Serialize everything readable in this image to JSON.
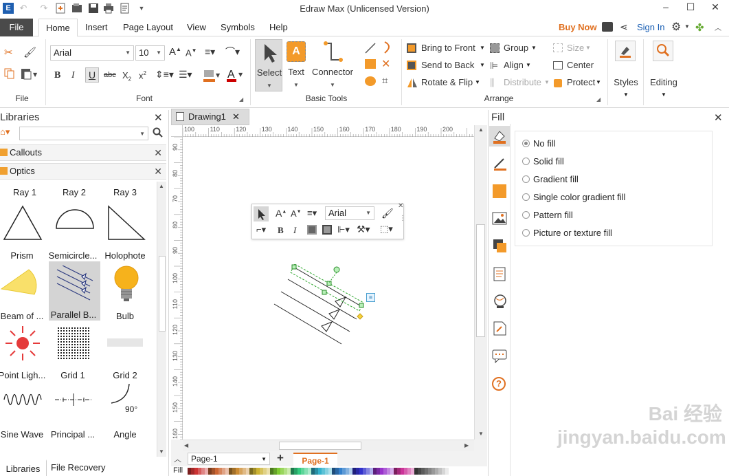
{
  "app": {
    "title": "Edraw Max (Unlicensed Version)"
  },
  "tabs": [
    "File",
    "Home",
    "Insert",
    "Page Layout",
    "View",
    "Symbols",
    "Help"
  ],
  "account": {
    "buy_now": "Buy Now",
    "sign_in": "Sign In"
  },
  "ribbon": {
    "groups": {
      "file": "File",
      "font": "Font",
      "basic_tools": "Basic Tools",
      "arrange": "Arrange"
    },
    "font_name": "Arial",
    "font_size": "10",
    "basic_tools": {
      "select": "Select",
      "text": "Text",
      "connector": "Connector"
    },
    "arrange": {
      "bring_to_front": "Bring to Front",
      "send_to_back": "Send to Back",
      "rotate_flip": "Rotate & Flip",
      "group": "Group",
      "align": "Align",
      "distribute": "Distribute",
      "size": "Size",
      "center": "Center",
      "protect": "Protect"
    },
    "styles": "Styles",
    "editing": "Editing"
  },
  "libraries": {
    "title": "Libraries",
    "categories": [
      "Callouts",
      "Optics"
    ],
    "shapes": [
      [
        "Ray 1",
        "Ray 2",
        "Ray 3"
      ],
      [
        "Prism",
        "Semicircle...",
        "Holophote"
      ],
      [
        "Beam of ...",
        "Parallel B...",
        "Bulb"
      ],
      [
        "Point Ligh...",
        "Grid 1",
        "Grid 2"
      ],
      [
        "Sine Wave",
        "Principal ...",
        "Angle"
      ]
    ],
    "angle_label": "90°",
    "bottom_tabs": [
      "Libraries",
      "File Recovery"
    ]
  },
  "document": {
    "tab": "Drawing1",
    "h_ruler": [
      "100",
      "110",
      "120",
      "130",
      "140",
      "150",
      "160",
      "170",
      "180",
      "190",
      "200"
    ],
    "v_ruler": [
      "90",
      "80",
      "70",
      "80",
      "90",
      "100",
      "110",
      "120",
      "130",
      "140",
      "150",
      "160"
    ],
    "float_font": "Arial"
  },
  "fill": {
    "title": "Fill",
    "options": [
      "No fill",
      "Solid fill",
      "Gradient fill",
      "Single color gradient fill",
      "Pattern fill",
      "Picture or texture fill"
    ],
    "selected": "No fill"
  },
  "pages": {
    "current": "Page-1",
    "tab": "Page-1"
  },
  "fillbar_label": "Fill",
  "watermark": "Bai 经验 jingyan.baidu.com"
}
